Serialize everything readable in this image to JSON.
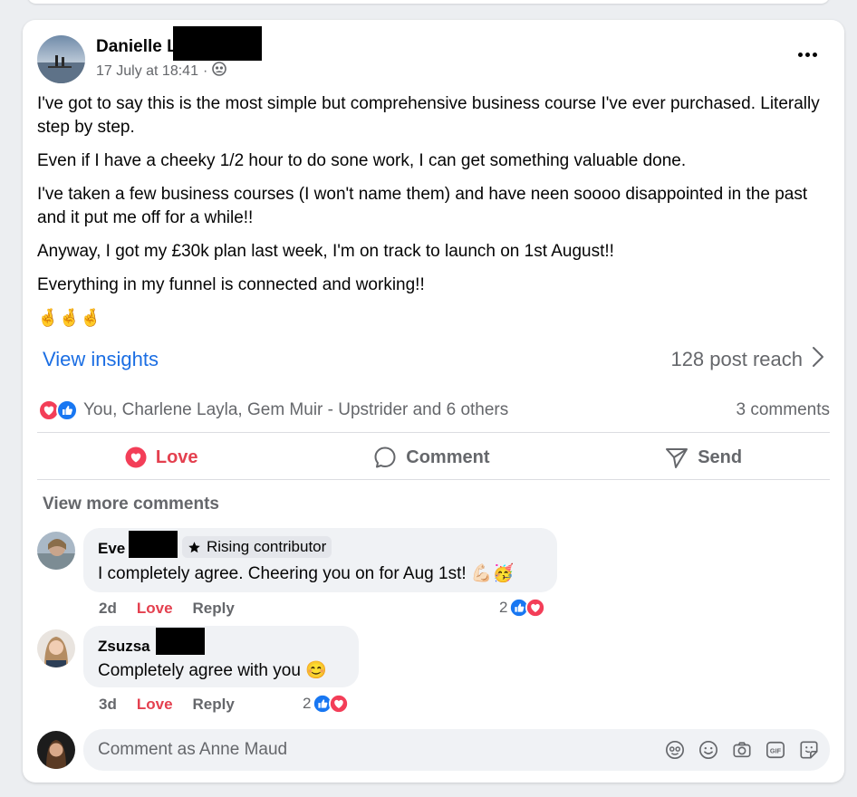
{
  "post": {
    "author_name": "Danielle L",
    "timestamp": "17 July at 18:41",
    "meta_separator": "·",
    "audience_icon": "friends-icon",
    "body": [
      "I've got to say this is the most simple but comprehensive business course I've ever purchased. Literally step by step.",
      "Even if I have a cheeky 1/2 hour to do sone work, I can get something valuable done.",
      "I've taken a few business courses  (I won't name them) and have neen soooo disappointed in the past and it put me off for a while!!",
      "Anyway, I got my £30k plan last week, I'm on track to launch on 1st August!!",
      "Everything in my funnel is connected and working!!"
    ],
    "emoji_line": "🤞🤞🤞",
    "more_icon": "more-options-icon"
  },
  "insights": {
    "view_label": "View insights",
    "reach_label": "128 post reach"
  },
  "reactions": {
    "summary": "You, Charlene Layla, Gem Muir - Upstrider and 6 others",
    "comments_count": "3 comments"
  },
  "actions": {
    "love": "Love",
    "comment": "Comment",
    "send": "Send"
  },
  "comments_section": {
    "view_more": "View more comments",
    "items": [
      {
        "name": "Eve",
        "badge": "Rising contributor",
        "text": "I completely agree. Cheering you on for Aug 1st! 💪🏻🥳",
        "time": "2d",
        "love": "Love",
        "reply": "Reply",
        "reaction_count": "2"
      },
      {
        "name": "Zsuzsa",
        "text": "Completely agree with you 😊",
        "time": "3d",
        "love": "Love",
        "reply": "Reply",
        "reaction_count": "2"
      }
    ]
  },
  "composer": {
    "placeholder": "Comment as Anne Maud",
    "icons": [
      "avatar-sticker-icon",
      "emoji-icon",
      "camera-icon",
      "gif-icon",
      "sticker-icon"
    ]
  },
  "colors": {
    "link_blue": "#1b6ee3",
    "love_red": "#e4404f",
    "like_blue": "#1877f2",
    "muted_text": "#65676b",
    "bubble_bg": "#f0f2f5"
  }
}
